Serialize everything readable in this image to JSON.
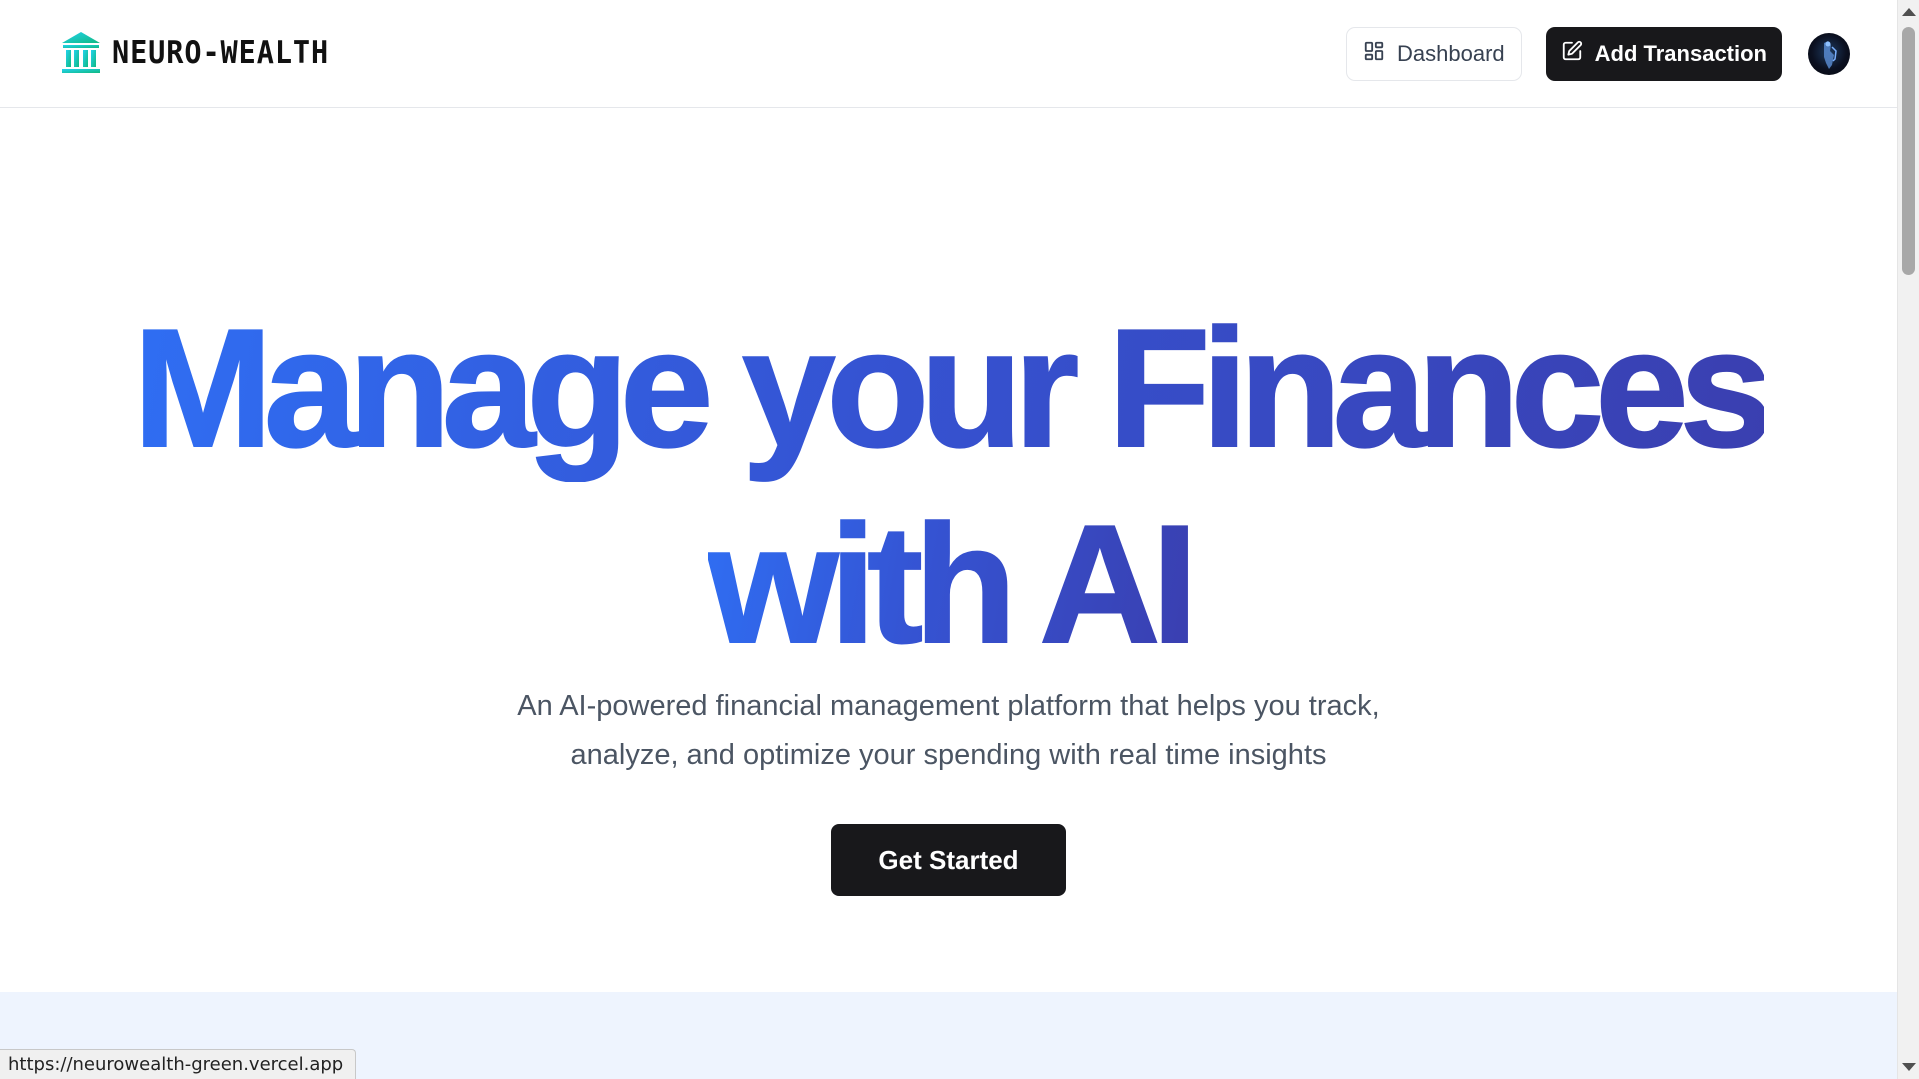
{
  "header": {
    "logo_text": "NEURO-WEALTH",
    "logo_icon": "bank-icon",
    "dashboard_label": "Dashboard",
    "dashboard_icon": "layout-grid-icon",
    "add_transaction_label": "Add Transaction",
    "add_transaction_icon": "pen-square-icon",
    "avatar_icon": "user-avatar"
  },
  "hero": {
    "title_line1": "Manage your Finances",
    "title_line2": "with AI",
    "subtitle_line1": "An AI-powered financial management platform that helps you track,",
    "subtitle_line2": "analyze, and optimize your spending with real time insights",
    "cta_label": "Get Started"
  },
  "status_bar": {
    "url": "https://neurowealth-green.vercel.app"
  },
  "colors": {
    "gradient_start": "#2f6ef3",
    "gradient_end": "#3a3fb0",
    "dark_button": "#18181b",
    "logo_accent": "#14b8a6",
    "lower_section_bg": "#eef4fe"
  }
}
